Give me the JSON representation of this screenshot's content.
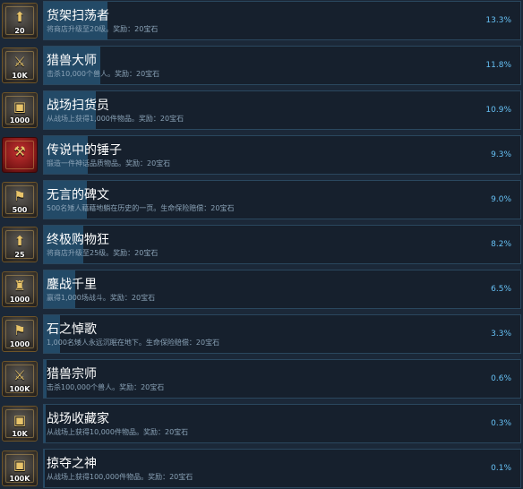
{
  "achievements": [
    {
      "title": "货架扫荡者",
      "description": "将商店升级至20级。奖励：20宝石",
      "percent_label": "13.3%",
      "percent": 13.3,
      "icon": "arrow-up-chest-icon",
      "icon_glyph": "⬆",
      "icon_caption": "20",
      "icon_style": "dark"
    },
    {
      "title": "猎兽大师",
      "description": "击杀10,000个兽人。奖励：20宝石",
      "percent_label": "11.8%",
      "percent": 11.8,
      "icon": "sword-chest-icon",
      "icon_glyph": "⚔",
      "icon_caption": "10K",
      "icon_style": "dark"
    },
    {
      "title": "战场扫货员",
      "description": "从战场上获得1,000件物品。奖励：20宝石",
      "percent_label": "10.9%",
      "percent": 10.9,
      "icon": "chest-icon",
      "icon_glyph": "▣",
      "icon_caption": "1000",
      "icon_style": "dark"
    },
    {
      "title": "传说中的锤子",
      "description": "锻造一件神话品质物品。奖励：20宝石",
      "percent_label": "9.3%",
      "percent": 9.3,
      "icon": "hammer-icon",
      "icon_glyph": "⚒",
      "icon_caption": "",
      "icon_style": "red"
    },
    {
      "title": "无言的碑文",
      "description": "500名矮人藉藉地躺在历史的一页。生命保险赔偿：20宝石",
      "percent_label": "9.0%",
      "percent": 9.0,
      "icon": "axe-chest-icon",
      "icon_glyph": "⚑",
      "icon_caption": "500",
      "icon_style": "dark"
    },
    {
      "title": "终极购物狂",
      "description": "将商店升级至25级。奖励：20宝石",
      "percent_label": "8.2%",
      "percent": 8.2,
      "icon": "arrow-up-chest-icon",
      "icon_glyph": "⬆",
      "icon_caption": "25",
      "icon_style": "dark"
    },
    {
      "title": "鏖战千里",
      "description": "赢得1,000场战斗。奖励：20宝石",
      "percent_label": "6.5%",
      "percent": 6.5,
      "icon": "dwarf-warrior-icon",
      "icon_glyph": "♜",
      "icon_caption": "1000",
      "icon_style": "dark"
    },
    {
      "title": "石之悼歌",
      "description": "1,000名矮人永远沉眠在地下。生命保险赔偿：20宝石",
      "percent_label": "3.3%",
      "percent": 3.3,
      "icon": "axe-chest-icon",
      "icon_glyph": "⚑",
      "icon_caption": "1000",
      "icon_style": "dark"
    },
    {
      "title": "猎兽宗师",
      "description": "击杀100,000个兽人。奖励：20宝石",
      "percent_label": "0.6%",
      "percent": 0.6,
      "icon": "sword-chest-icon",
      "icon_glyph": "⚔",
      "icon_caption": "100K",
      "icon_style": "dark"
    },
    {
      "title": "战场收藏家",
      "description": "从战场上获得10,000件物品。奖励：20宝石",
      "percent_label": "0.3%",
      "percent": 0.3,
      "icon": "chest-icon",
      "icon_glyph": "▣",
      "icon_caption": "10K",
      "icon_style": "dark"
    },
    {
      "title": "掠夺之神",
      "description": "从战场上获得100,000件物品。奖励：20宝石",
      "percent_label": "0.1%",
      "percent": 0.1,
      "icon": "chest-icon",
      "icon_glyph": "▣",
      "icon_caption": "100K",
      "icon_style": "dark"
    }
  ],
  "colors": {
    "background": "#1b2838",
    "bar_fill": "#234a67",
    "percent_text": "#66c0f4",
    "title_text": "#ffffff",
    "description_text": "#8aa2b6"
  }
}
